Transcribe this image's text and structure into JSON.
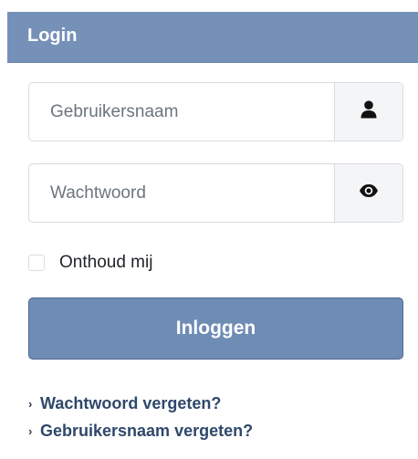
{
  "header": {
    "title": "Login"
  },
  "form": {
    "username": {
      "placeholder": "Gebruikersnaam",
      "value": "",
      "icon": "user-icon"
    },
    "password": {
      "placeholder": "Wachtwoord",
      "value": "",
      "icon": "eye-icon"
    },
    "remember": {
      "label": "Onthoud mij",
      "checked": false
    },
    "submit_label": "Inloggen"
  },
  "links": [
    {
      "label": "Wachtwoord vergeten?"
    },
    {
      "label": "Gebruikersnaam vergeten?"
    }
  ],
  "colors": {
    "header_bg": "#7691b8",
    "button_bg": "#6f8cb5",
    "link": "#2f486b"
  }
}
